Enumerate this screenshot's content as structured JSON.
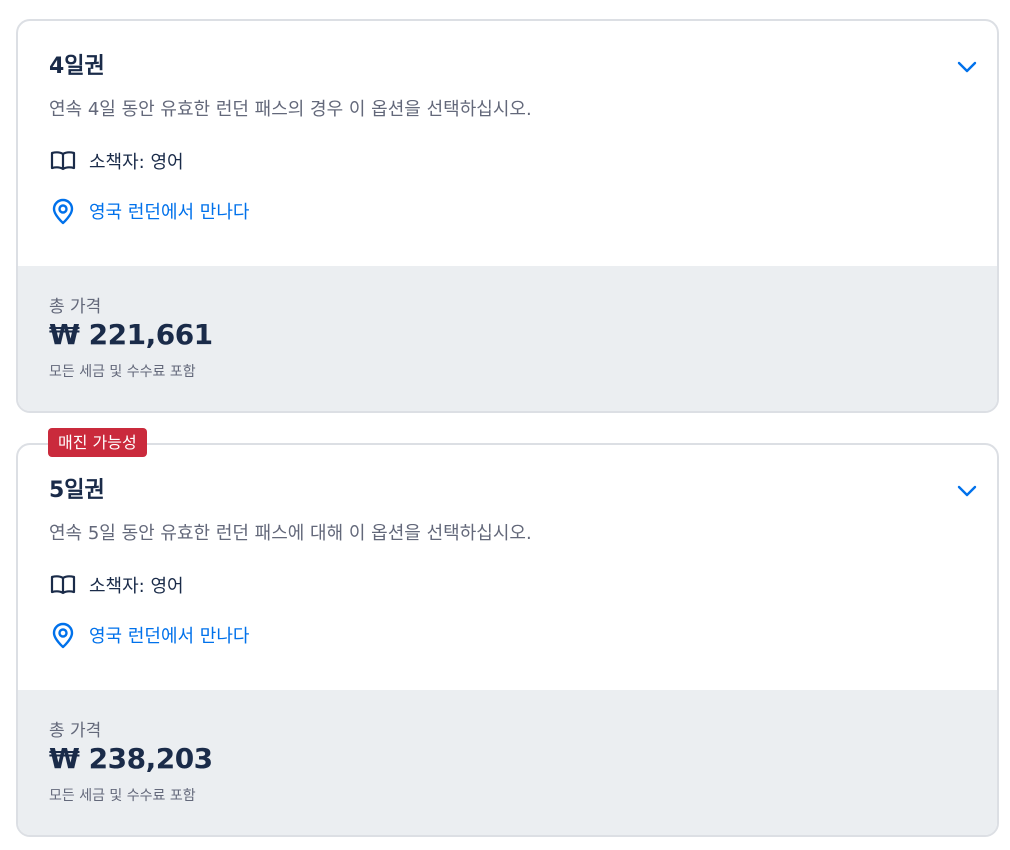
{
  "options": [
    {
      "title": "4일권",
      "description": "연속 4일 동안 유효한 런던 패스의 경우 이 옵션을 선택하십시오.",
      "guide": "소책자: 영어",
      "meeting_point": "영국 런던에서 만나다",
      "price_label": "총 가격",
      "price": "₩ 221,661",
      "price_note": "모든 세금 및 수수료 포함",
      "badge": ""
    },
    {
      "title": "5일권",
      "description": "연속 5일 동안 유효한 런던 패스에 대해 이 옵션을 선택하십시오.",
      "guide": "소책자: 영어",
      "meeting_point": "영국 런던에서 만나다",
      "price_label": "총 가격",
      "price": "₩ 238,203",
      "price_note": "모든 세금 및 수수료 포함",
      "badge": "매진 가능성"
    }
  ],
  "icons": {
    "expand": "chevron-down-icon",
    "guide": "book-icon",
    "location": "map-pin-icon"
  },
  "colors": {
    "text_primary": "#1a2b49",
    "text_secondary": "#63687a",
    "link": "#0071eb",
    "footer_bg": "#ebeef1",
    "badge_bg": "#ca2a3c",
    "border": "#dcdfe4"
  }
}
